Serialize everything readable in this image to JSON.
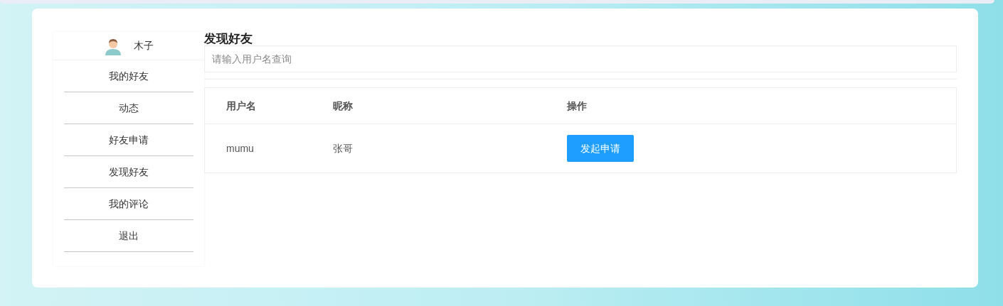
{
  "user": {
    "name": "木子"
  },
  "menu": [
    "我的好友",
    "动态",
    "好友申请",
    "发现好友",
    "我的评论",
    "退出"
  ],
  "page_title": "发现好友",
  "search": {
    "placeholder": "请输入用户名查询"
  },
  "table": {
    "columns": [
      "用户名",
      "昵称",
      "操作"
    ],
    "rows": [
      {
        "username": "mumu",
        "nickname": "张哥",
        "action": "发起申请"
      }
    ]
  }
}
